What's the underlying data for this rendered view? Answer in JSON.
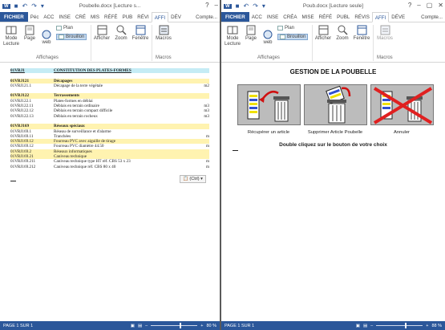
{
  "left": {
    "title": "Poubelle.docx [Lecture s...",
    "tabs": [
      "FICHIER",
      "Péc",
      "ACC",
      "INSE",
      "CRÉ",
      "MIS",
      "RÉFÉ",
      "PUB",
      "RÉVI",
      "AFFI",
      "DÉV"
    ],
    "account": "Compte...",
    "ribbon": {
      "mode_lecture": "Mode Lecture",
      "page": "Page",
      "web": "web",
      "plan": "Plan",
      "brouillon": "Brouillon",
      "afficher": "Afficher",
      "zoom": "Zoom",
      "fenetre": "Fenêtre",
      "macros": "Macros",
      "group_affichages": "Affichages",
      "group_macros": "Macros"
    },
    "rows": [
      {
        "code": "01VRJ1",
        "text": "CONSTITUTION DES PLATES-FORMES",
        "unit": "",
        "style": "head"
      },
      {
        "code": "",
        "text": "",
        "unit": "",
        "style": "blank"
      },
      {
        "code": "01VRJ121",
        "text": "Décapages",
        "unit": "",
        "style": "sec"
      },
      {
        "code": "01VRJ121.1",
        "text": "Décapage de la terre végétale",
        "unit": "m2",
        "style": ""
      },
      {
        "code": "",
        "text": "",
        "unit": "",
        "style": "blank"
      },
      {
        "code": "01VRJ122",
        "text": "Terrassements",
        "unit": "",
        "style": "sec"
      },
      {
        "code": "01VRJ122.1",
        "text": "Plates-formes en déblai",
        "unit": "",
        "style": ""
      },
      {
        "code": "01VRJ122.11",
        "text": "Déblais en terrain ordinaire",
        "unit": "m3",
        "style": ""
      },
      {
        "code": "01VRJ122.12",
        "text": "Déblais en terrain compact difficile",
        "unit": "m3",
        "style": ""
      },
      {
        "code": "01VRJ122.13",
        "text": "Déblais en terrain rocheux",
        "unit": "m3",
        "style": ""
      },
      {
        "code": "",
        "text": "",
        "unit": "",
        "style": "blank"
      },
      {
        "code": "01VRJ169",
        "text": "Réseaux spéciaux",
        "unit": "",
        "style": "sec"
      },
      {
        "code": "01VRJ169.1",
        "text": "Réseau de surveillance et d'alarme",
        "unit": "",
        "style": ""
      },
      {
        "code": "01VRJ169.11",
        "text": "Tranchées",
        "unit": "m",
        "style": ""
      },
      {
        "code": "01VRJ169.12",
        "text": "Fourreau PVC avec aiguille de tirage",
        "unit": "",
        "style": "hl"
      },
      {
        "code": "01VRJ169.12",
        "text": "Fourreau PVC diamètre 44.50",
        "unit": "m",
        "style": ""
      },
      {
        "code": "01VRJ169.2",
        "text": "Réseaux informatiques",
        "unit": "",
        "style": "hl"
      },
      {
        "code": "01VRJ169.21",
        "text": "Caniveau technique",
        "unit": "",
        "style": "hl"
      },
      {
        "code": "01VRJ169.211",
        "text": "Caniveau technique type HT réf. CBS 53 x 23",
        "unit": "m",
        "style": ""
      },
      {
        "code": "01VRJ169.212",
        "text": "Caniveau technique réf. CBS 80 x 40",
        "unit": "m",
        "style": ""
      }
    ],
    "paste_ctrl": "(Ctrl)",
    "status_page": "PAGE 1 SUR 1",
    "zoom": "80 %"
  },
  "right": {
    "title": "Poub.docx [Lecture seule]",
    "tabs": [
      "FICHIER",
      "ACC",
      "INSE",
      "CRÉA",
      "MISE",
      "RÉFÉ",
      "PUBL",
      "RÉVIS",
      "AFFI",
      "DÉVE"
    ],
    "account": "Compte...",
    "ribbon": {
      "mode_lecture": "Mode Lecture",
      "page": "Page",
      "web": "web",
      "plan": "Plan",
      "brouillon": "Brouillon",
      "afficher": "Afficher",
      "zoom": "Zoom",
      "fenetre": "Fenêtre",
      "macros": "Macros",
      "group_affichages": "Affichages",
      "group_macros": "Macros"
    },
    "heading": "GESTION DE LA POUBELLE",
    "buttons": [
      {
        "label": "Récupérer un article"
      },
      {
        "label": "Supprimer Article Poubelle"
      },
      {
        "label": "Annuler"
      }
    ],
    "hint": "Double cliquez sur le bouton de votre choix",
    "status_page": "PAGE 1 SUR 1",
    "zoom": "88 %"
  },
  "colors": {
    "brand": "#2b579a",
    "highlight_yellow": "#fff3b0",
    "highlight_blue": "#c5ecf5",
    "cancel_red": "#e02020"
  }
}
